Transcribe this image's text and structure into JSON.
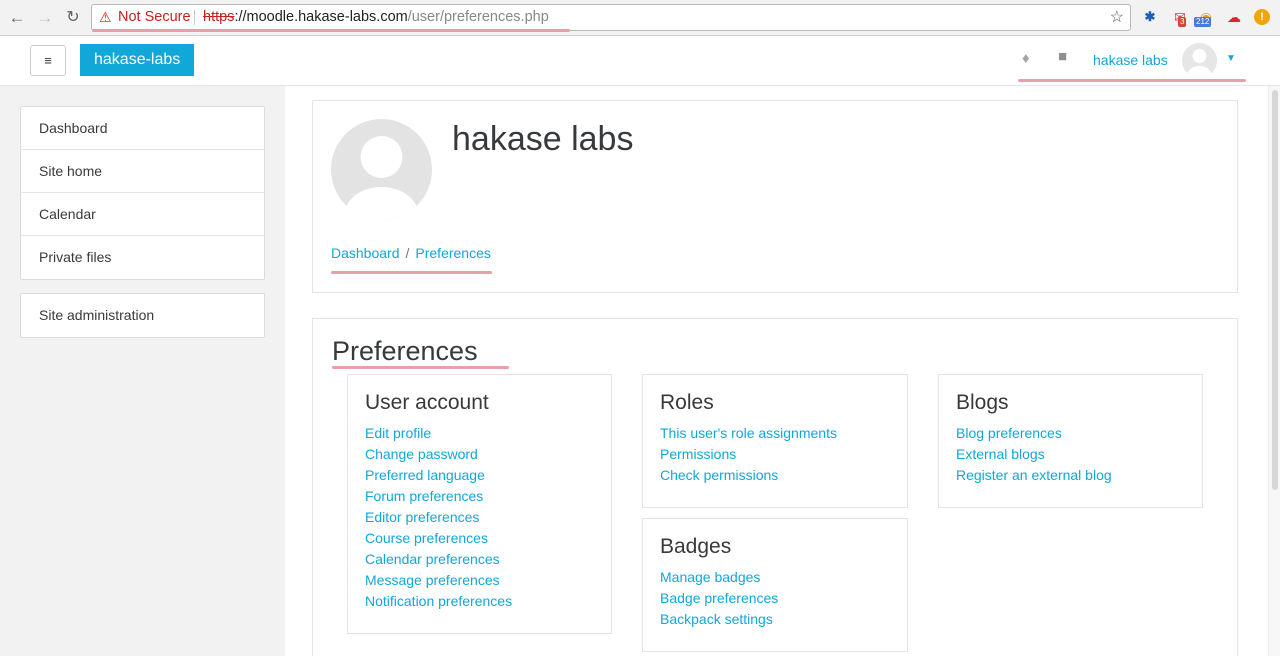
{
  "browser": {
    "security_label": "Not Secure",
    "url_scheme": "https",
    "url_host": "://moodle.hakase-labs.com",
    "url_path": "/user/preferences.php",
    "extensions": [
      {
        "name": "puzzle-icon"
      },
      {
        "name": "gmail-icon",
        "badge": "3"
      },
      {
        "name": "rss-icon",
        "badge": "212"
      },
      {
        "name": "cloud-icon"
      },
      {
        "name": "alert-icon",
        "glyph": "!"
      }
    ]
  },
  "navbar": {
    "brand": "hakase-labs",
    "user_name": "hakase labs"
  },
  "drawer": {
    "items": [
      "Dashboard",
      "Site home",
      "Calendar",
      "Private files"
    ],
    "admin_item": "Site administration"
  },
  "header": {
    "title": "hakase labs",
    "breadcrumb": [
      "Dashboard",
      "Preferences"
    ]
  },
  "preferences": {
    "title": "Preferences",
    "sections": {
      "user_account": {
        "title": "User account",
        "links": [
          "Edit profile",
          "Change password",
          "Preferred language",
          "Forum preferences",
          "Editor preferences",
          "Course preferences",
          "Calendar preferences",
          "Message preferences",
          "Notification preferences"
        ]
      },
      "roles": {
        "title": "Roles",
        "links": [
          "This user's role assignments",
          "Permissions",
          "Check permissions"
        ]
      },
      "badges": {
        "title": "Badges",
        "links": [
          "Manage badges",
          "Badge preferences",
          "Backpack settings"
        ]
      },
      "blogs": {
        "title": "Blogs",
        "links": [
          "Blog preferences",
          "External blogs",
          "Register an external blog"
        ]
      }
    }
  },
  "colors": {
    "accent": "#11a7d8",
    "insecure": "#c5221f",
    "highlight": "#e8a0a8"
  }
}
